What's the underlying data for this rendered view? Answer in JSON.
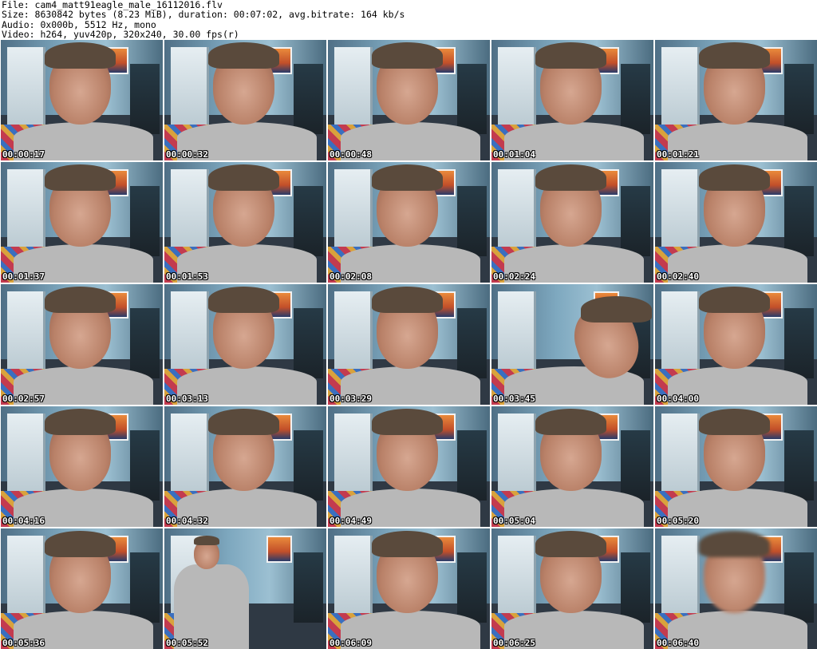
{
  "header": {
    "file_line": "File: cam4_matt91eagle_male_16112016.flv",
    "size_line": "Size: 8630842 bytes (8.23 MiB), duration: 00:07:02, avg.bitrate: 164 kb/s",
    "audio_line": "Audio: 0x000b, 5512 Hz, mono",
    "video_line": "Video: h264, yuv420p, 320x240, 30.00 fps(r)"
  },
  "thumbnails": [
    {
      "timestamp": "00:00:17"
    },
    {
      "timestamp": "00:00:32"
    },
    {
      "timestamp": "00:00:48"
    },
    {
      "timestamp": "00:01:04"
    },
    {
      "timestamp": "00:01:21"
    },
    {
      "timestamp": "00:01:37"
    },
    {
      "timestamp": "00:01:53"
    },
    {
      "timestamp": "00:02:08"
    },
    {
      "timestamp": "00:02:24"
    },
    {
      "timestamp": "00:02:40"
    },
    {
      "timestamp": "00:02:57"
    },
    {
      "timestamp": "00:03:13"
    },
    {
      "timestamp": "00:03:29"
    },
    {
      "timestamp": "00:03:45"
    },
    {
      "timestamp": "00:04:00"
    },
    {
      "timestamp": "00:04:16"
    },
    {
      "timestamp": "00:04:32"
    },
    {
      "timestamp": "00:04:49"
    },
    {
      "timestamp": "00:05:04"
    },
    {
      "timestamp": "00:05:20"
    },
    {
      "timestamp": "00:05:36"
    },
    {
      "timestamp": "00:05:52"
    },
    {
      "timestamp": "00:06:09"
    },
    {
      "timestamp": "00:06:25"
    },
    {
      "timestamp": "00:06:40"
    }
  ]
}
